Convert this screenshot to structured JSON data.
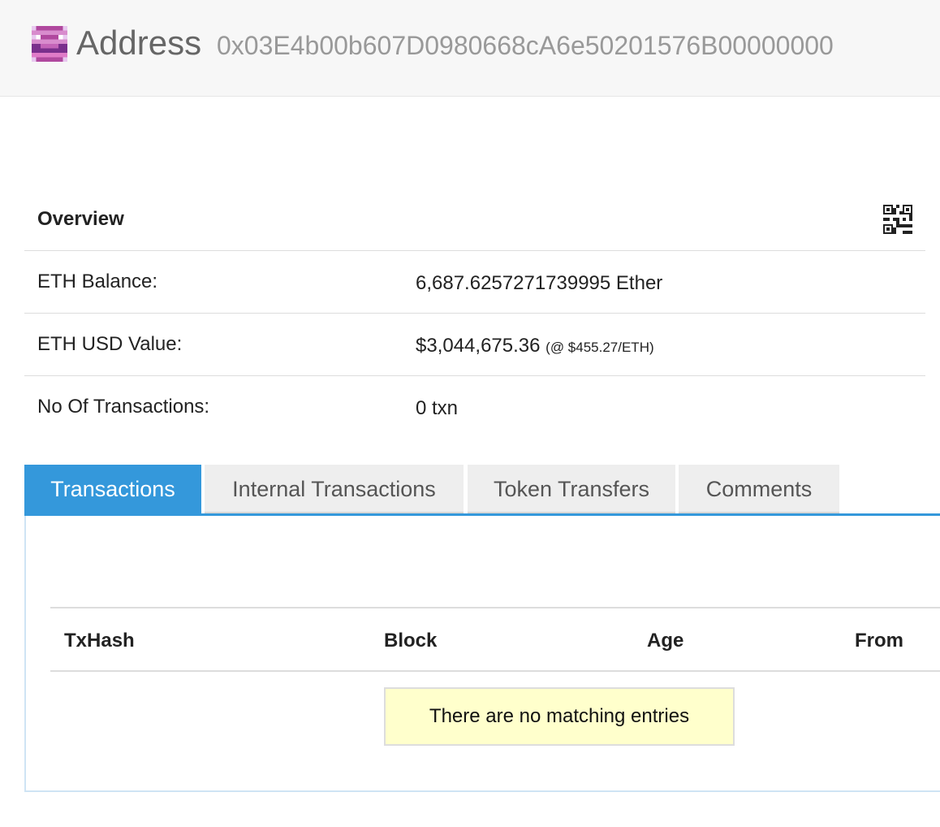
{
  "header": {
    "title": "Address",
    "address": "0x03E4b00b607D0980668cA6e50201576B00000000"
  },
  "overview": {
    "title": "Overview",
    "rows": [
      {
        "label": "ETH Balance:",
        "value": "6,687.6257271739995 Ether",
        "note": ""
      },
      {
        "label": "ETH USD Value:",
        "value": "$3,044,675.36",
        "note": "(@ $455.27/ETH)"
      },
      {
        "label": "No Of Transactions:",
        "value": "0 txn",
        "note": ""
      }
    ]
  },
  "tabs": [
    {
      "label": "Transactions",
      "active": true
    },
    {
      "label": "Internal Transactions",
      "active": false
    },
    {
      "label": "Token Transfers",
      "active": false
    },
    {
      "label": "Comments",
      "active": false
    }
  ],
  "transactions_table": {
    "columns": [
      "TxHash",
      "Block",
      "Age",
      "From"
    ],
    "empty_message": "There are no matching entries"
  },
  "colors": {
    "accent": "#3498db",
    "header_bg": "#f7f7f7",
    "empty_bg": "#ffffcc"
  }
}
